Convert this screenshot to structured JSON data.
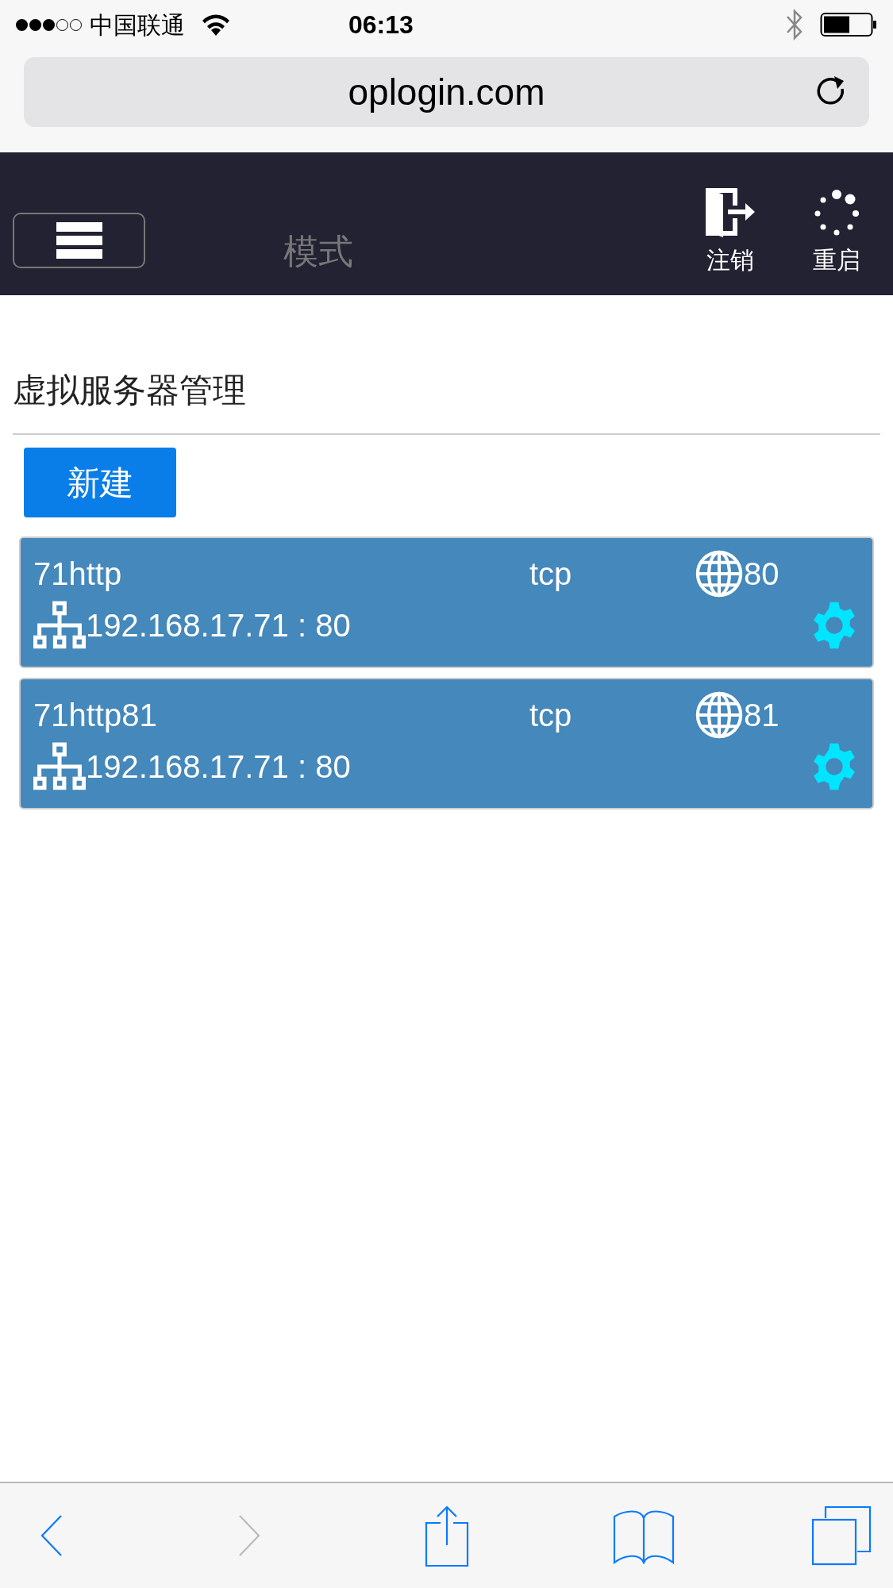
{
  "status_bar": {
    "carrier": "中国联通",
    "time": "06:13"
  },
  "browser": {
    "url": "oplogin.com"
  },
  "navbar": {
    "mode_label": "模式",
    "actions": [
      {
        "kind": "logout",
        "label": "注销"
      },
      {
        "kind": "restart",
        "label": "重启"
      }
    ]
  },
  "page": {
    "title": "虚拟服务器管理",
    "new_button": "新建"
  },
  "servers": [
    {
      "name": "71http",
      "protocol": "tcp",
      "external_port": "80",
      "internal_address": "192.168.17.71 : 80"
    },
    {
      "name": "71http81",
      "protocol": "tcp",
      "external_port": "81",
      "internal_address": "192.168.17.71 : 80"
    }
  ],
  "toolbar": [
    {
      "kind": "back",
      "disabled": false
    },
    {
      "kind": "forward",
      "disabled": true
    },
    {
      "kind": "share",
      "disabled": false
    },
    {
      "kind": "bookmarks",
      "disabled": false
    },
    {
      "kind": "tabs",
      "disabled": false
    }
  ]
}
